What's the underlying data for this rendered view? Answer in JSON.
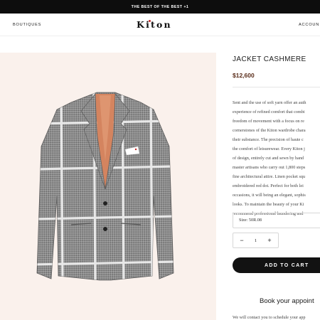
{
  "announcement": {
    "text": "THE BEST OF THE BEST +1"
  },
  "header": {
    "lead_fragment": "l",
    "nav_left": "BOUTIQUES",
    "logo": "Kiton",
    "nav_right": "ACCOUN"
  },
  "product": {
    "title": "JACKET CASHMERE",
    "price": "$12,600",
    "description_lines": [
      "Sent and the use of soft yarn offer an auth",
      "experience of refined comfort that combi",
      "freedom of movement with a focus on re",
      "cornerstones of the Kiton wardrobe chara",
      "their substance. The precision of haute c",
      "the comfort of leisurewear. Every Kiton j",
      "of design, entirely cut and sewn by hand",
      "master artisans who carry out 1,800 steps",
      "fine architectural attire. Linen pocket squ",
      "embroidered red dot. Perfect for both lei",
      "occasions, it will being an elegant, sophis",
      "looks. To maintain the beauty of your Ki",
      "recommend professional laundering and"
    ],
    "size_label": "Size: 50R.08",
    "quantity": "1",
    "qty_minus": "−",
    "qty_plus": "+",
    "add_to_cart": "ADD TO CART"
  },
  "appointment": {
    "title": "Book your appoint",
    "text": "We will contact you to schedule your app"
  },
  "colors": {
    "announcement_bg": "#0d0d0d",
    "image_bg": "#faf1ec",
    "price": "#5a2d1a",
    "button_bg": "#121212",
    "logo_dot": "#c62828"
  }
}
